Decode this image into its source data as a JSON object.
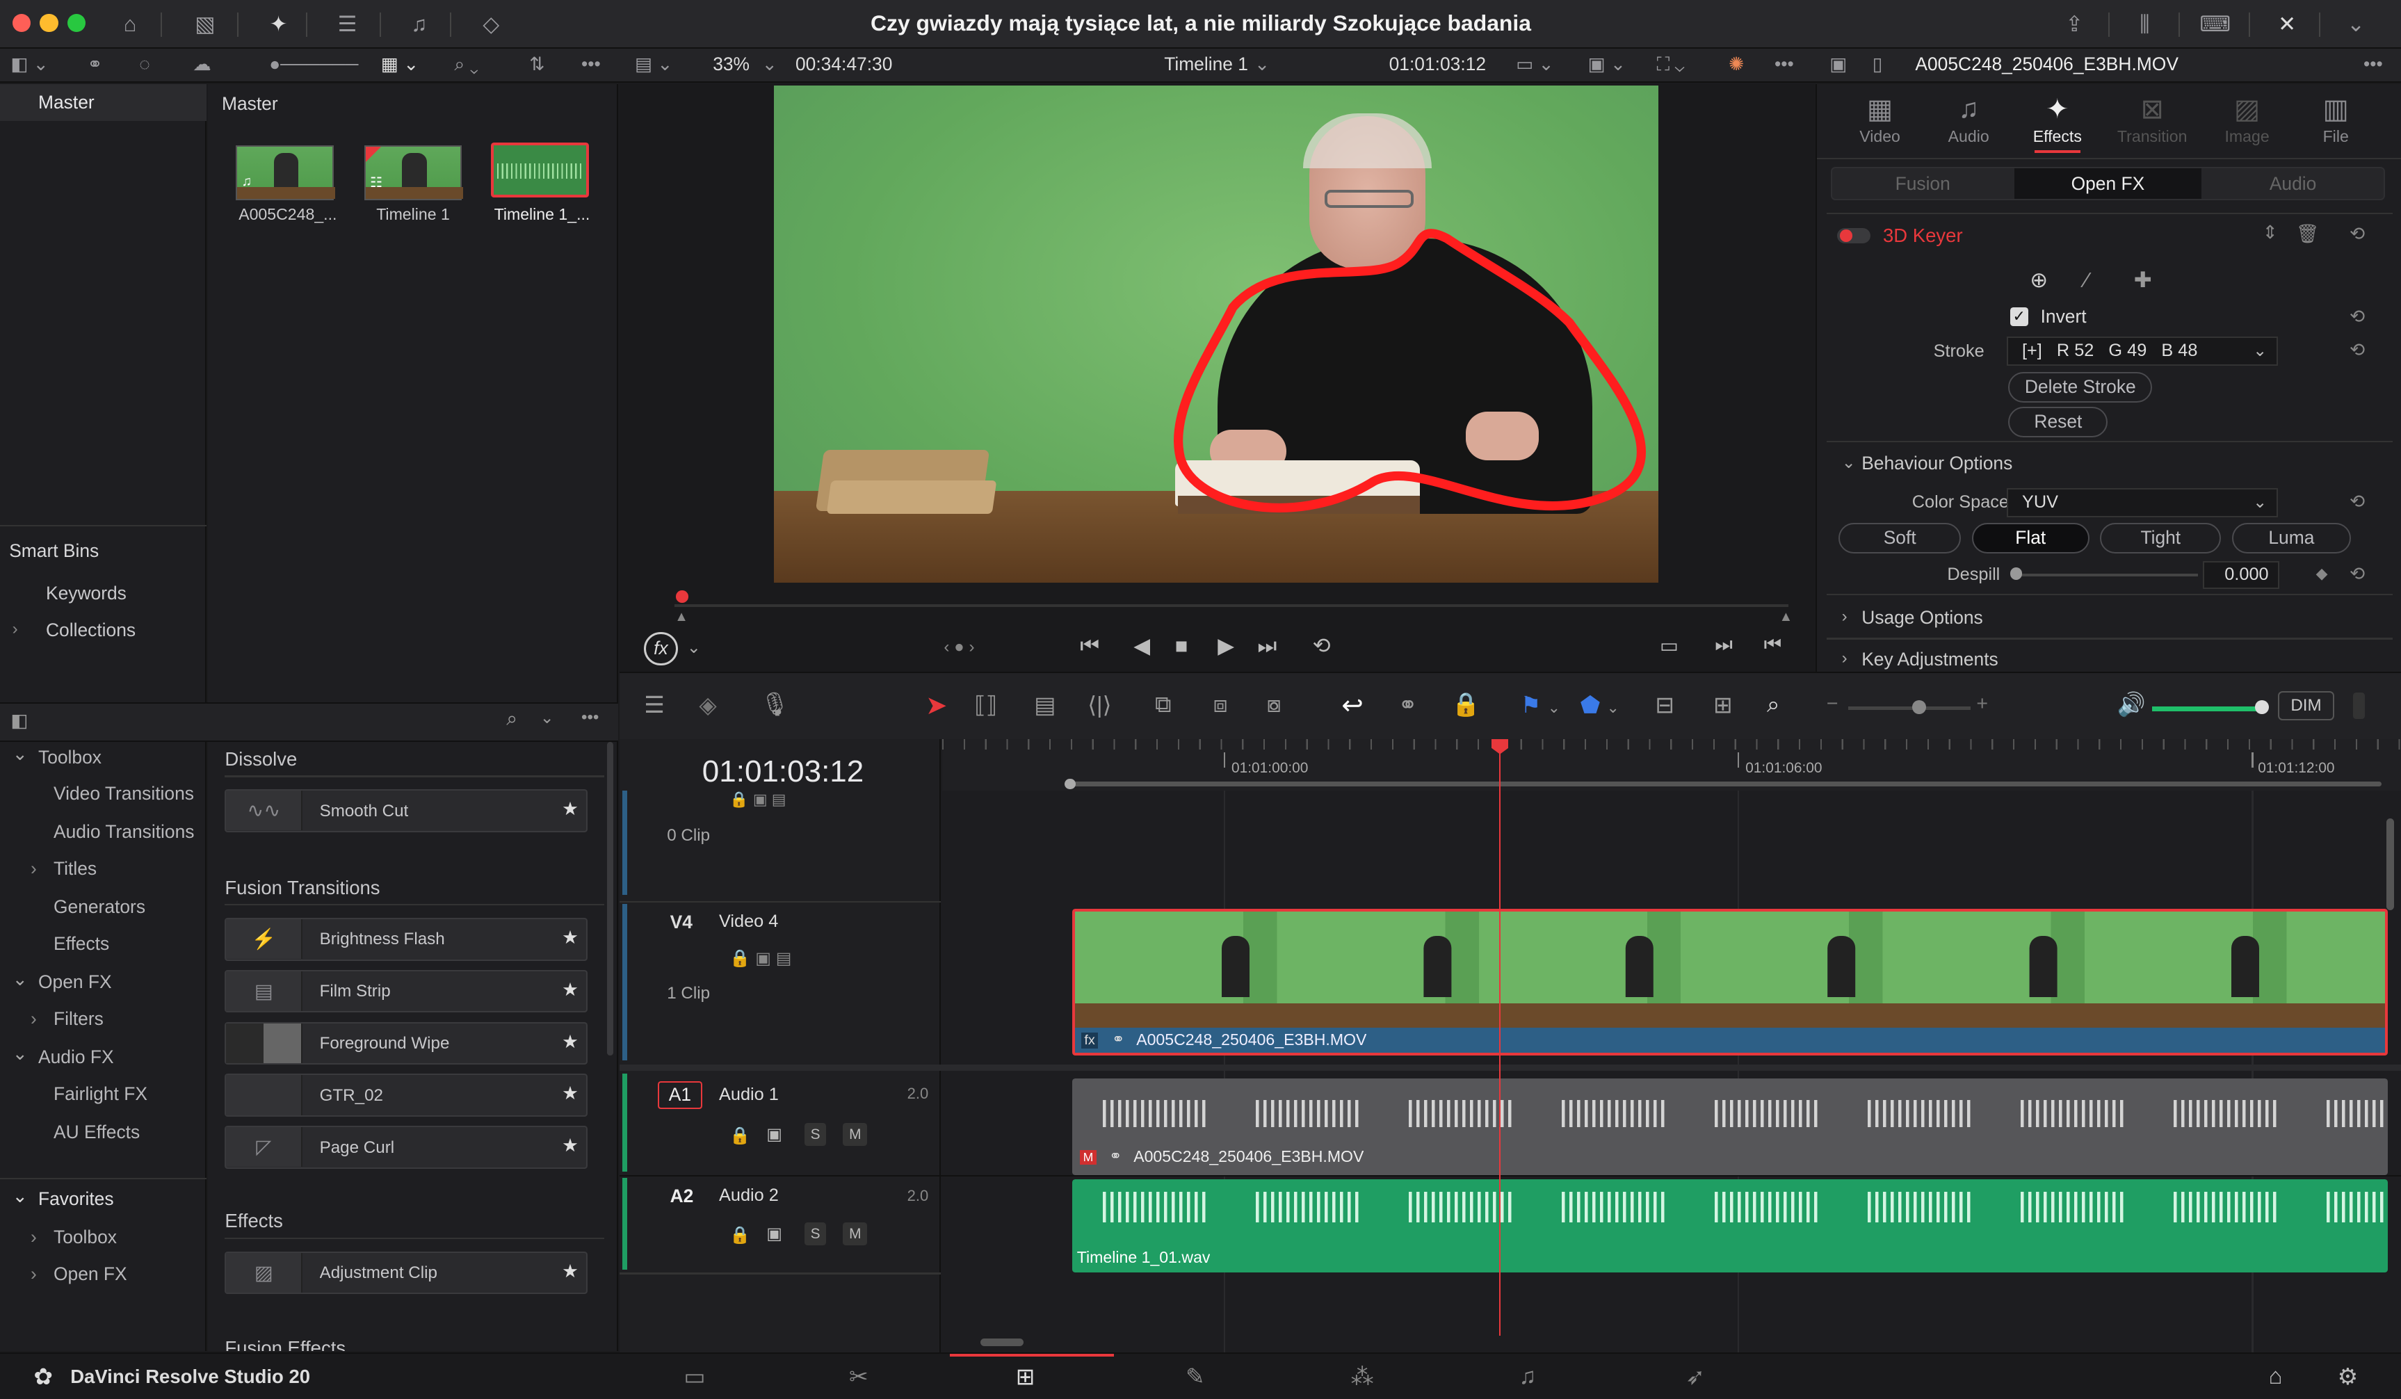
{
  "window": {
    "title": "Czy gwiazdy mają tysiące lat, a nie miliardy Szokujące badania"
  },
  "viewer": {
    "zoom": "33%",
    "source_timecode": "00:34:47:30",
    "timeline_name": "Timeline 1",
    "record_timecode": "01:01:03:12",
    "clip_name": "A005C248_250406_E3BH.MOV"
  },
  "media_pool": {
    "bin_label": "Master",
    "pane_title": "Master",
    "clips": [
      {
        "name": "A005C248_..."
      },
      {
        "name": "Timeline 1"
      },
      {
        "name": "Timeline 1_..."
      }
    ]
  },
  "smart_bins": {
    "title": "Smart Bins",
    "items": [
      "Keywords",
      "Collections"
    ]
  },
  "effects_tree": {
    "toolbox": "Toolbox",
    "video_transitions": "Video Transitions",
    "audio_transitions": "Audio Transitions",
    "titles": "Titles",
    "generators": "Generators",
    "effects": "Effects",
    "open_fx": "Open FX",
    "filters": "Filters",
    "audio_fx": "Audio FX",
    "fairlight_fx": "Fairlight FX",
    "au_effects": "AU Effects",
    "favorites": "Favorites",
    "fav_toolbox": "Toolbox",
    "fav_open_fx": "Open FX"
  },
  "effects_list": {
    "dissolve": {
      "title": "Dissolve",
      "items": [
        "Smooth Cut"
      ]
    },
    "fusion_transitions": {
      "title": "Fusion Transitions",
      "items": [
        "Brightness Flash",
        "Film Strip",
        "Foreground Wipe",
        "GTR_02",
        "Page Curl"
      ]
    },
    "effects": {
      "title": "Effects",
      "items": [
        "Adjustment Clip"
      ]
    },
    "fusion_effects": {
      "title": "Fusion Effects"
    }
  },
  "inspector": {
    "tabs": [
      "Video",
      "Audio",
      "Effects",
      "Transition",
      "Image",
      "File"
    ],
    "active_tab": "Effects",
    "subtabs": [
      "Fusion",
      "Open FX",
      "Audio"
    ],
    "effect_name": "3D Keyer",
    "invert_label": "Invert",
    "stroke_label": "Stroke",
    "stroke_value": "[+]   R 52   G 49   B 48",
    "delete_stroke": "Delete Stroke",
    "reset": "Reset",
    "behaviour_options": "Behaviour Options",
    "color_space_label": "Color Space",
    "color_space_value": "YUV",
    "modes": [
      "Soft",
      "Flat",
      "Tight",
      "Luma"
    ],
    "active_mode": "Flat",
    "despill_label": "Despill",
    "despill_value": "0.000",
    "usage_options": "Usage Options",
    "key_adjustments": "Key Adjustments"
  },
  "timeline": {
    "timecode": "01:01:03:12",
    "ruler": [
      "01:01:00:00",
      "01:01:06:00",
      "01:01:12:00"
    ],
    "dim_label": "DIM",
    "tracks": [
      {
        "id": "",
        "name": "",
        "clips": "0 Clip"
      },
      {
        "id": "V4",
        "name": "Video 4",
        "clips": "1 Clip"
      },
      {
        "id": "A1",
        "name": "Audio 1",
        "channels": "2.0"
      },
      {
        "id": "A2",
        "name": "Audio 2",
        "channels": "2.0"
      }
    ],
    "v4_clip": "A005C248_250406_E3BH.MOV",
    "a1_clip": "A005C248_250406_E3BH.MOV",
    "a2_clip": "Timeline 1_01.wav",
    "solo": "S",
    "mute": "M"
  },
  "app": {
    "name": "DaVinci Resolve Studio 20"
  },
  "colors": {
    "accent_red": "#e8383c",
    "audio_green": "#1f9e63",
    "video_clip_blue": "#2d5f86",
    "keyer_red": "#ff1e1e"
  }
}
